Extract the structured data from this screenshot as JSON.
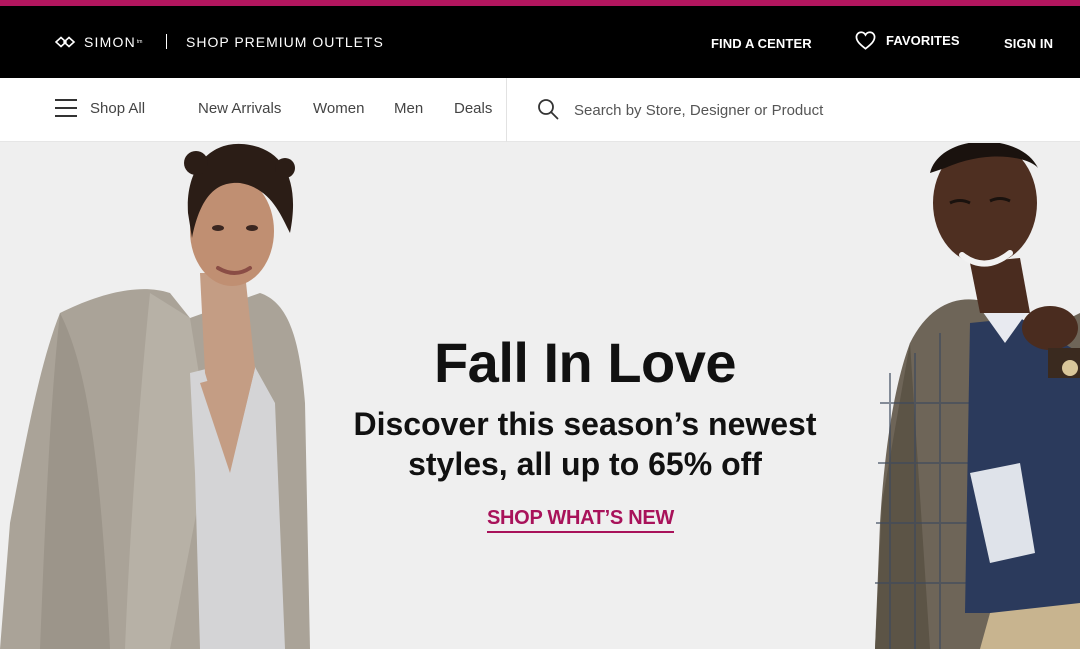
{
  "theme": {
    "accent": "#b2165e",
    "header_bg": "#000000",
    "cta_color": "#a8125a",
    "hero_bg": "#efefef"
  },
  "header": {
    "brand": "SIMON",
    "brand_mark": "tm",
    "tagline": "SHOP PREMIUM OUTLETS",
    "find_center": "FIND A CENTER",
    "favorites": "FAVORITES",
    "sign_in": "SIGN IN"
  },
  "nav": {
    "shop_all": "Shop All",
    "items": [
      "New Arrivals",
      "Women",
      "Men",
      "Deals"
    ],
    "search_placeholder": "Search by Store, Designer or Product"
  },
  "hero": {
    "title": "Fall In Love",
    "subtitle_line1": "Discover this season’s newest",
    "subtitle_line2": "styles, all up to 65% off",
    "cta": "SHOP WHAT’S NEW"
  },
  "icons": [
    "simon-logo-icon",
    "heart-icon",
    "hamburger-menu-icon",
    "search-icon"
  ]
}
